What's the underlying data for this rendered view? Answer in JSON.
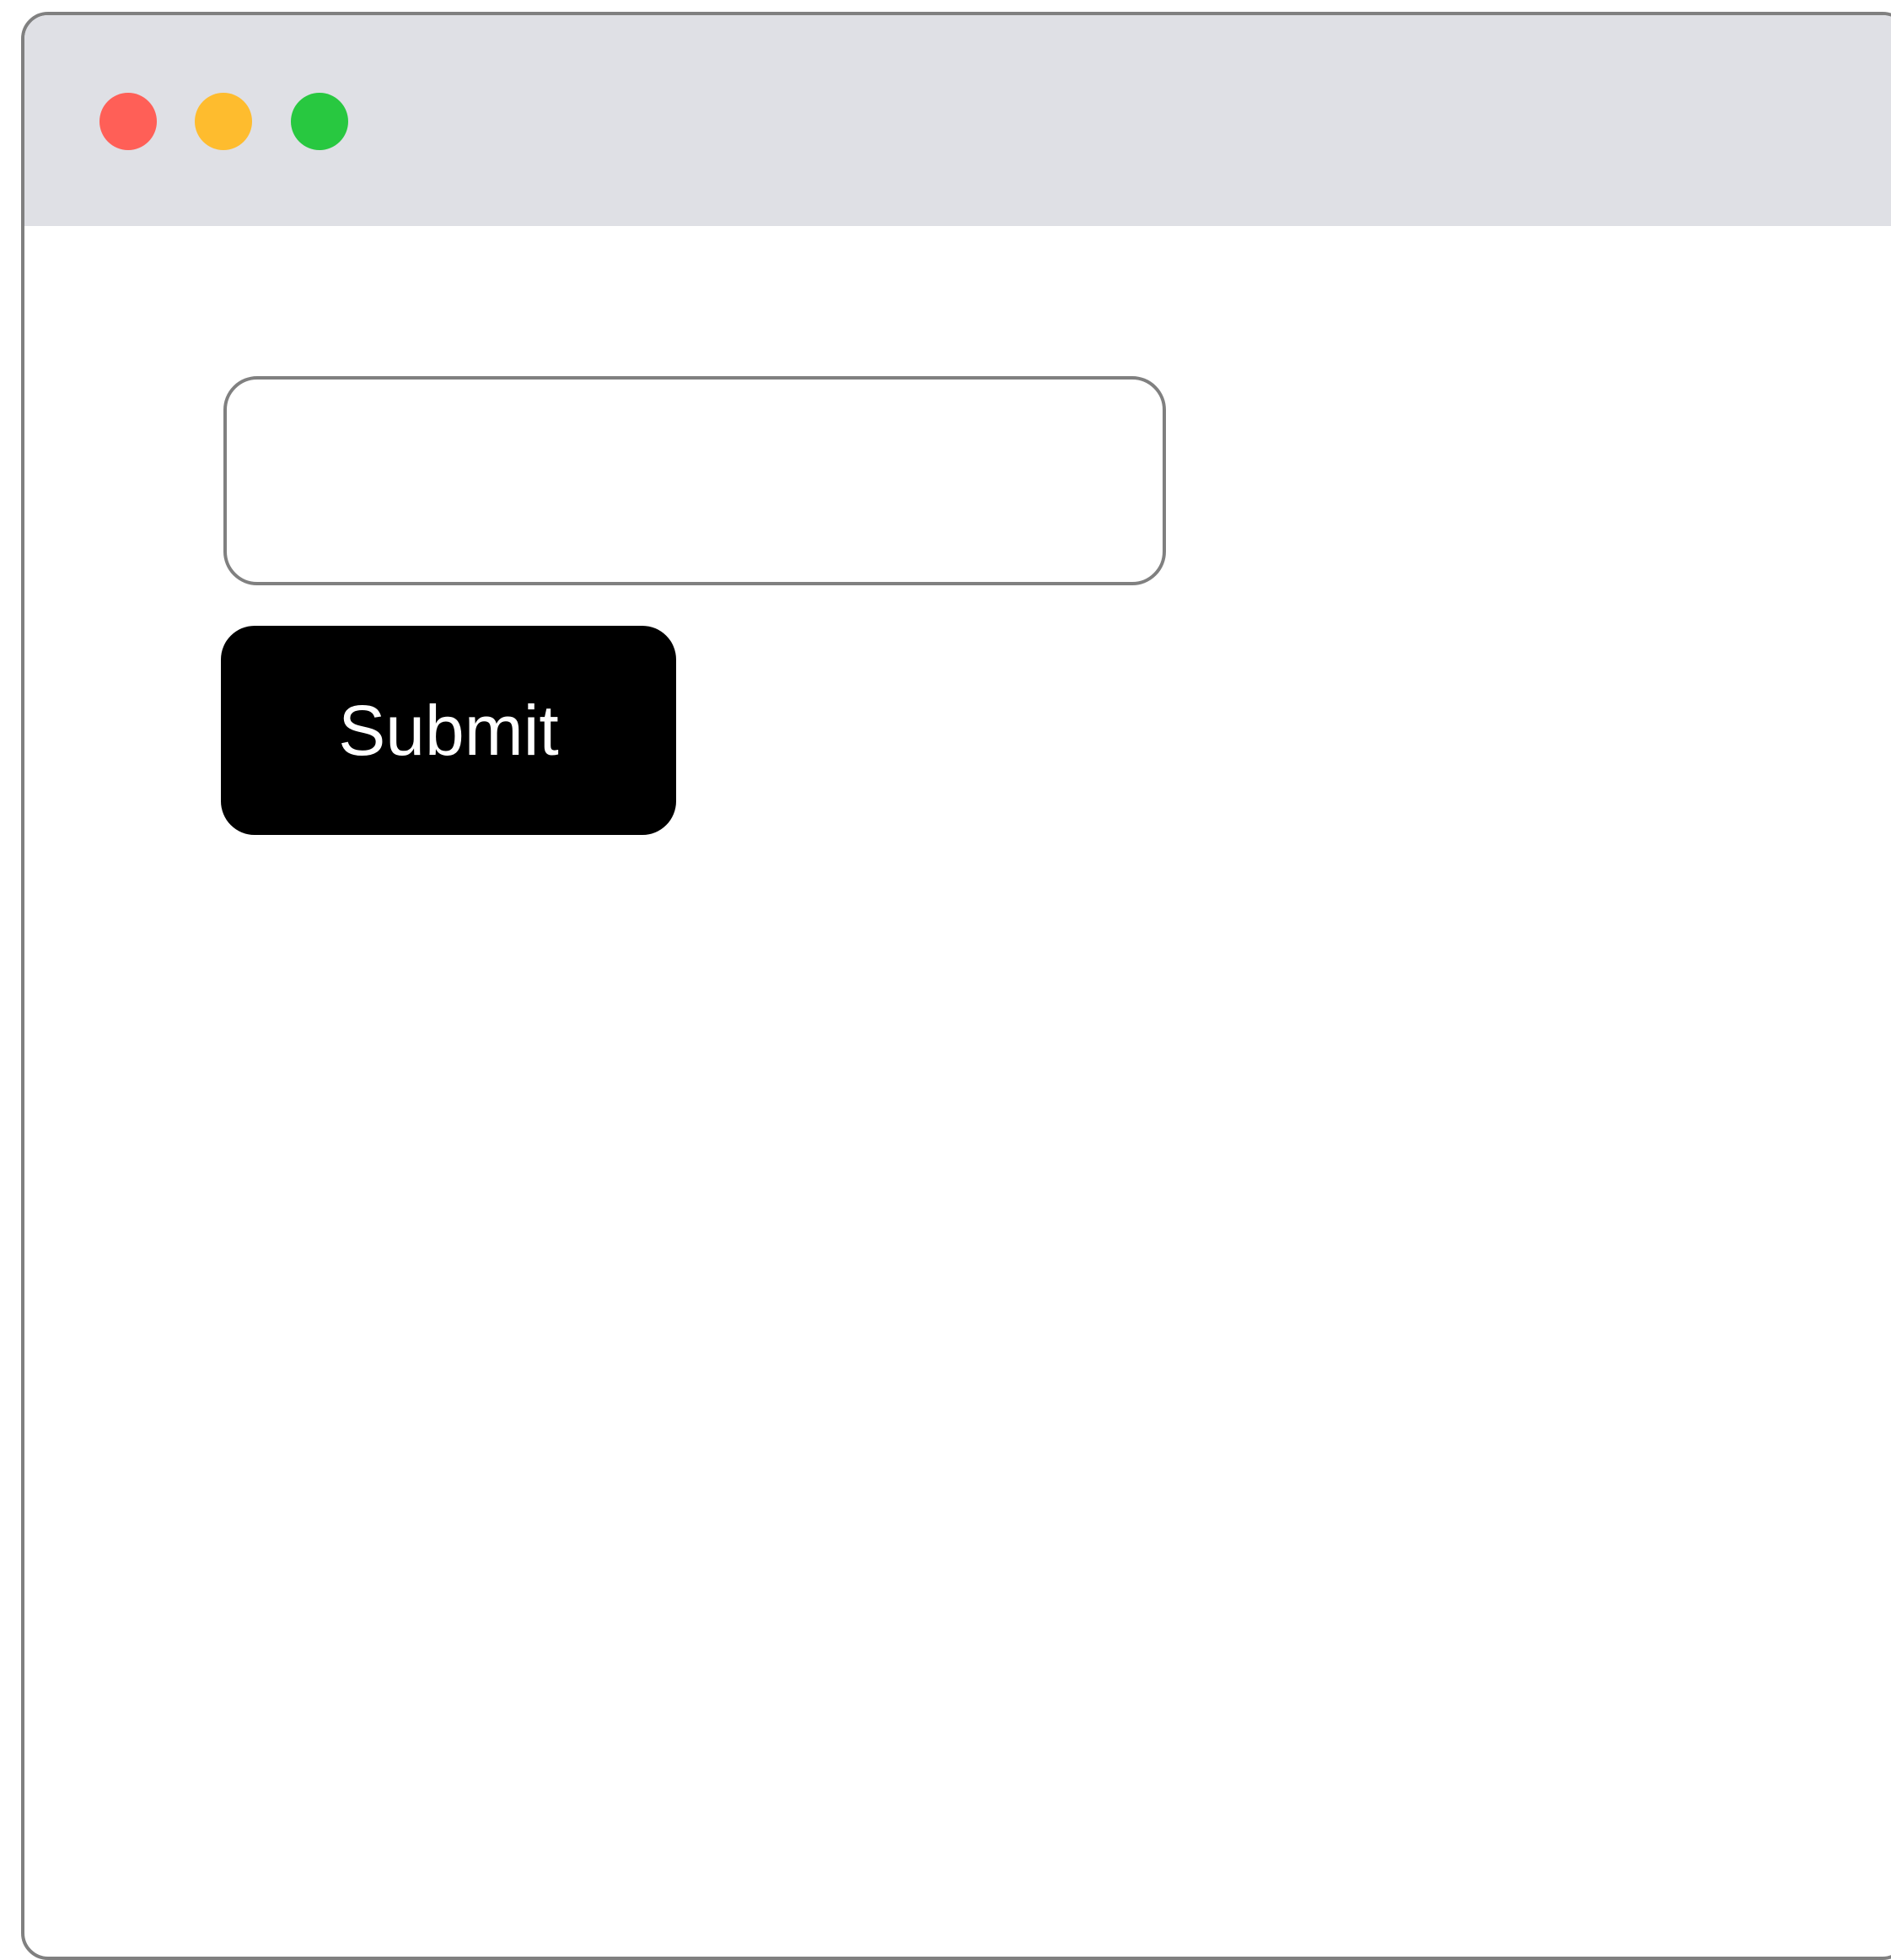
{
  "window": {
    "traffic_lights": {
      "close": {
        "icon": "close-traffic-light-icon",
        "color": "#ff5f57"
      },
      "minimize": {
        "icon": "minimize-traffic-light-icon",
        "color": "#febc2e"
      },
      "zoom": {
        "icon": "zoom-traffic-light-icon",
        "color": "#28c840"
      }
    },
    "titlebar_color": "#dfe0e5"
  },
  "form": {
    "input_value": "",
    "submit_label": "Submit",
    "submit_color": "#000000"
  }
}
